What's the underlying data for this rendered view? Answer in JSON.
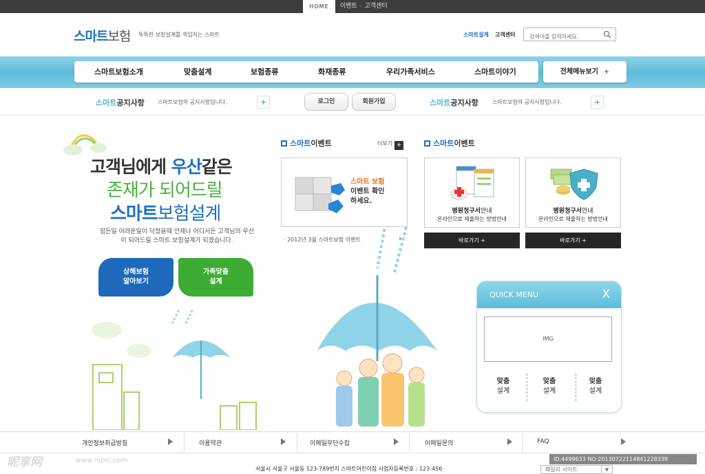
{
  "topbar": {
    "home": "HOME",
    "links": [
      "이벤트",
      "고객센터"
    ]
  },
  "header": {
    "logo_a": "스마트",
    "logo_b": "보험",
    "slogan": "똑똑한 보험설계를 책임지는 스마트",
    "link_smart": "스마트설계",
    "link_cs": "고객센터",
    "search_placeholder": "검색어를 입력하세요."
  },
  "nav": {
    "items": [
      "스마트보험소개",
      "맞춤설계",
      "보험종류",
      "화재종류",
      "우리가족서비스",
      "스마트이야기"
    ],
    "all_menu": "전체메뉴보기",
    "all_menu_plus": "+"
  },
  "notice": {
    "left_title_a": "스마트",
    "left_title_b": "공지사항",
    "left_text": "스마트보험의 공지사항입니다.",
    "login": "로그인",
    "join": "회원가입",
    "right_title_a": "스마트",
    "right_title_b": "공지사항",
    "right_text": "스마트보험의 공지사항입니다.",
    "plus": "+"
  },
  "hero": {
    "line1_a": "고객님에게 ",
    "line1_b": "우산",
    "line1_c": "같은",
    "line2": "존재가 되어드릴",
    "line3_a": "스마트",
    "line3_b": "보험설계",
    "sub": "힘든일 어려운일이 닥쳤을때 언제나 어디서든 고객님의 우산이 되어드릴 스마트 보험설계가 되겠습니다.",
    "btn_blue_1": "상해보험",
    "btn_blue_2": "알아보기",
    "btn_green_1": "가족맞춤",
    "btn_green_2": "설계"
  },
  "event_main": {
    "title_a": "스마트",
    "title_b": "이벤트",
    "more": "더보기",
    "more_plus": "+",
    "box_line1": "스마트 보험",
    "box_line2": "이벤트 확인",
    "box_line3": "하세요.",
    "list_item": "2012년 3월 스마트보험 이벤트",
    "arrow": "›"
  },
  "event_cards": {
    "title_a": "스마트",
    "title_b": "이벤트",
    "cards": [
      {
        "t1_bold": "병원청구서",
        "t1_rest": "안내",
        "t2": "온라인으로 재출하는 방법안내",
        "btn": "바로가기 +"
      },
      {
        "t1_bold": "병원청구서",
        "t1_rest": "안내",
        "t2": "온라인으로 재출하는 방법안내",
        "btn": "바로가기 +"
      }
    ]
  },
  "quick": {
    "title": "QUICK MENU",
    "close": "X",
    "img": "IMG",
    "items": [
      {
        "a": "맞춤",
        "b": "설계"
      },
      {
        "a": "맞춤",
        "b": "설계"
      },
      {
        "a": "맞춤",
        "b": "설계"
      }
    ]
  },
  "footer": {
    "items": [
      "개인정보취급방침",
      "이용약관",
      "이메일무단수집",
      "이메일문의",
      "FAQ"
    ],
    "address": "서울시 서울구 서울동 123-789번지 스마트어린이집 사업자등록번호 : 123-456",
    "family_site": "패밀리 사이트",
    "family_dd": "▼"
  },
  "watermark": {
    "logo": "昵享网",
    "url": "www.nipic.com",
    "id": "ID:4499633 NO:20130722114841228339"
  },
  "colors": {
    "brand_blue": "#1d6fc1",
    "brand_green": "#3eac34",
    "sky": "#5fbcd9"
  }
}
